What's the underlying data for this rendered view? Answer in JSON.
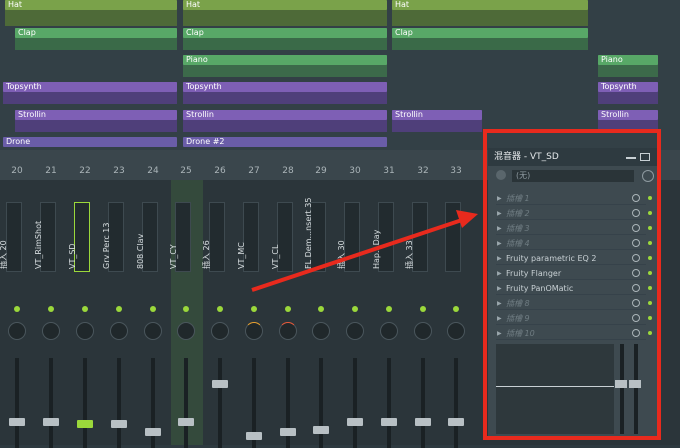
{
  "playlist": {
    "tracks": [
      {
        "name": "Hat",
        "color": "#7aa24a",
        "clips": [
          "Hat",
          "Hat",
          "Hat"
        ]
      },
      {
        "name": "Clap",
        "color": "#58a867",
        "clips": [
          "Clap",
          "Clap",
          "Clap"
        ]
      },
      {
        "name": "Piano",
        "color": "#58a867",
        "clips": [
          "Piano",
          "Piano"
        ]
      },
      {
        "name": "Topsynth",
        "color": "#7e5fb5",
        "clips": [
          "Topsynth",
          "Topsynth",
          "Topsynth"
        ]
      },
      {
        "name": "Strollin",
        "color": "#7e5fb5",
        "clips": [
          "Strollin",
          "Strollin",
          "Strollin",
          "Strollin"
        ]
      },
      {
        "name": "Drone",
        "color": "#6a5da8",
        "clips": [
          "Drone",
          "Drone #2"
        ]
      }
    ]
  },
  "mixer": {
    "channel_numbers": [
      "20",
      "21",
      "22",
      "23",
      "24",
      "25",
      "26",
      "27",
      "28",
      "29",
      "30",
      "31",
      "32",
      "33"
    ],
    "channels": [
      "插入 20",
      "VT_RimShot",
      "VT_SD",
      "Grv Perc 13",
      "808 Clav",
      "VT_CY",
      "插入 26",
      "VT_MC",
      "VT_CL",
      "FL Dem...nsert 35",
      "插入 30",
      "Hap...Day",
      "插入 33",
      ""
    ]
  },
  "panel": {
    "title": "混音器 - VT_SD",
    "preset": "(无)",
    "slots": [
      {
        "label": "插槽 1",
        "empty": true
      },
      {
        "label": "插槽 2",
        "empty": true
      },
      {
        "label": "插槽 3",
        "empty": true
      },
      {
        "label": "插槽 4",
        "empty": true
      },
      {
        "label": "Fruity parametric EQ 2",
        "empty": false
      },
      {
        "label": "Fruity Flanger",
        "empty": false
      },
      {
        "label": "Fruity PanOMatic",
        "empty": false
      },
      {
        "label": "插槽 8",
        "empty": true
      },
      {
        "label": "插槽 9",
        "empty": true
      },
      {
        "label": "插槽 10",
        "empty": true
      }
    ]
  },
  "colors": {
    "highlight": "#e82a1d",
    "led": "#9bd83b"
  }
}
